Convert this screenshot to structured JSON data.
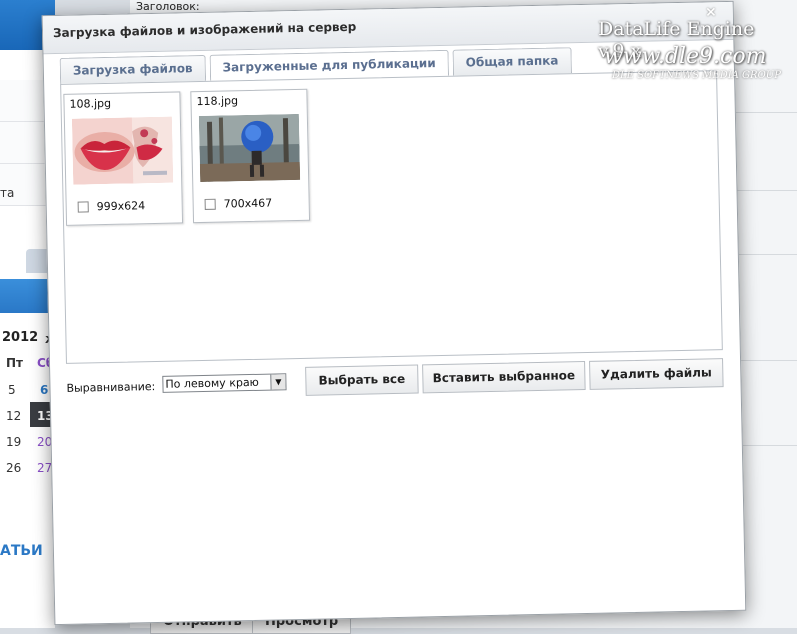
{
  "background": {
    "title_label": "Заголовок:",
    "sidebar_fragment": "та",
    "calendar": {
      "year": "2012",
      "col3_head": "ж",
      "headers": [
        "Пт",
        "Сб"
      ],
      "rows": [
        [
          "5",
          "6"
        ],
        [
          "12",
          "13"
        ],
        [
          "19",
          "20"
        ],
        [
          "26",
          "27"
        ]
      ]
    },
    "publish_fragment": "АТЬИ",
    "send_label": "Отправить",
    "preview_label": "Просмотр"
  },
  "watermark": {
    "line1": "DataLife Engine v.9.x",
    "line2": "www.dle9.com",
    "line3": "DLE SOFTNEWS MEDIA GROUP"
  },
  "dialog": {
    "title": "Загрузка файлов и изображений на сервер",
    "close_label": "×",
    "tabs": [
      {
        "label": "Загрузка файлов",
        "active": false
      },
      {
        "label": "Загруженные для публикации",
        "active": true
      },
      {
        "label": "Общая папка",
        "active": false
      }
    ],
    "files": [
      {
        "name": "108.jpg",
        "size": "999x624",
        "checked": false
      },
      {
        "name": "118.jpg",
        "size": "700x467",
        "checked": false
      }
    ],
    "alignment_label": "Выравнивание:",
    "alignment_value": "По левому краю",
    "buttons": {
      "select_all": "Выбрать все",
      "insert_selected": "Вставить выбранное",
      "delete_files": "Удалить файлы"
    }
  },
  "colors": {
    "accent_blue": "#2b78c5",
    "tab_text": "#5a6f8f",
    "today_bg": "#3a3d42"
  }
}
